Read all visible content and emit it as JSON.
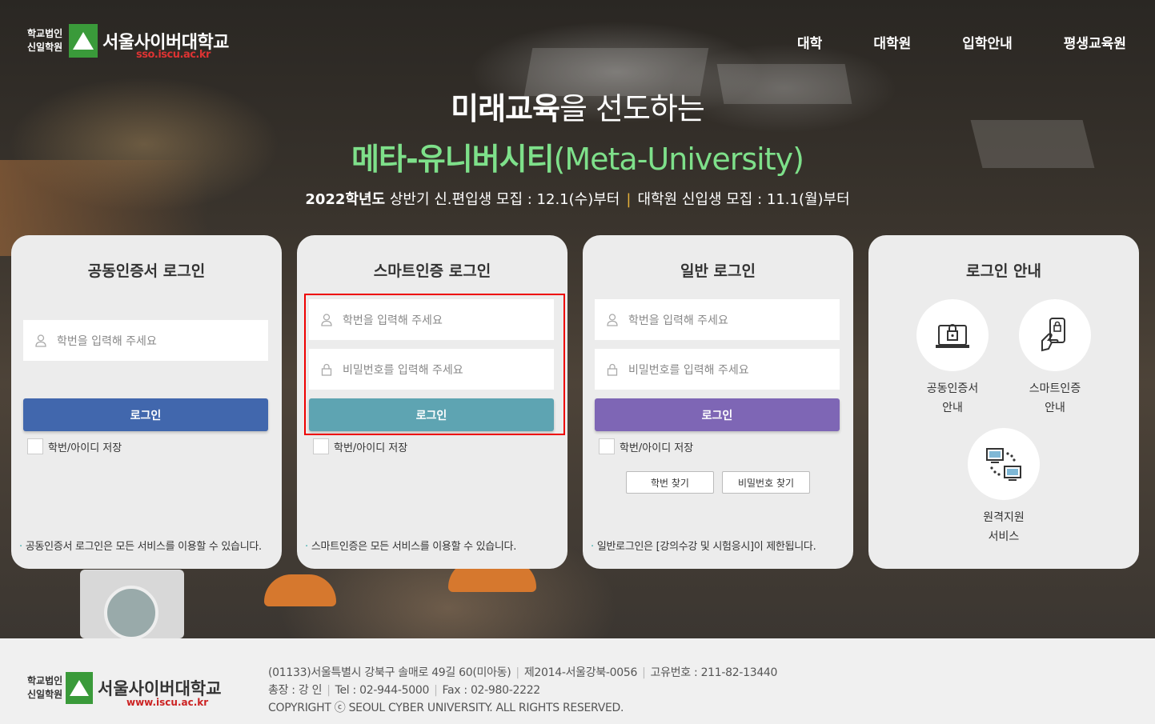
{
  "header": {
    "logo_corp_line1": "학교법인",
    "logo_corp_line2": "신일학원",
    "logo_name": "서울사이버대학교",
    "logo_sub": "sso.iscu.ac.kr",
    "nav": [
      "대학",
      "대학원",
      "입학안내",
      "평생교육원"
    ]
  },
  "headline": {
    "line1_bold": "미래교육",
    "line1_rest": "을 선도하는",
    "line2_bold": "메타-유니버시티",
    "line2_rest": "(Meta-University)",
    "line3_year": "2022학년도",
    "line3_a": "상반기 신.편입생 모집 : 12.1(수)부터",
    "line3_sep": "|",
    "line3_b": "대학원 신입생 모집 : 11.1(월)부터"
  },
  "cards": {
    "cert": {
      "title": "공동인증서 로그인",
      "id_placeholder": "학번을 입력해 주세요",
      "login_label": "로그인",
      "save_label": "학번/아이디 저장",
      "note": "공동인증서 로그인은 모든 서비스를 이용할 수 있습니다."
    },
    "smart": {
      "title": "스마트인증 로그인",
      "id_placeholder": "학번을 입력해 주세요",
      "pw_placeholder": "비밀번호를 입력해 주세요",
      "login_label": "로그인",
      "save_label": "학번/아이디 저장",
      "note": "스마트인증은 모든 서비스를 이용할 수 있습니다."
    },
    "general": {
      "title": "일반 로그인",
      "id_placeholder": "학번을 입력해 주세요",
      "pw_placeholder": "비밀번호를 입력해 주세요",
      "login_label": "로그인",
      "save_label": "학번/아이디 저장",
      "find_id": "학번 찾기",
      "find_pw": "비밀번호 찾기",
      "note": "일반로그인은 [강의수강 및 시험응시]이 제한됩니다."
    },
    "guide": {
      "title": "로그인 안내",
      "items": [
        {
          "line1": "공동인증서",
          "line2": "안내"
        },
        {
          "line1": "스마트인증",
          "line2": "안내"
        },
        {
          "line1": "원격지원",
          "line2": "서비스"
        }
      ]
    }
  },
  "colors": {
    "cert_button": "#4167ad",
    "smart_button": "#5ea4b2",
    "general_button": "#7e66b5"
  },
  "footer": {
    "corp_line1": "학교법인",
    "corp_line2": "신일학원",
    "name": "서울사이버대학교",
    "sub": "www.iscu.ac.kr",
    "address": "(01133)서울특별시 강북구 솔매로 49길 60(미아동)",
    "reg": "제2014-서울강북-0056",
    "bizno": "고유번호 : 211-82-13440",
    "president": "총장 : 강 인",
    "tel": "Tel : 02-944-5000",
    "fax": "Fax : 02-980-2222",
    "copyright": "COPYRIGHT ⓒ SEOUL CYBER UNIVERSITY. ALL RIGHTS RESERVED."
  }
}
